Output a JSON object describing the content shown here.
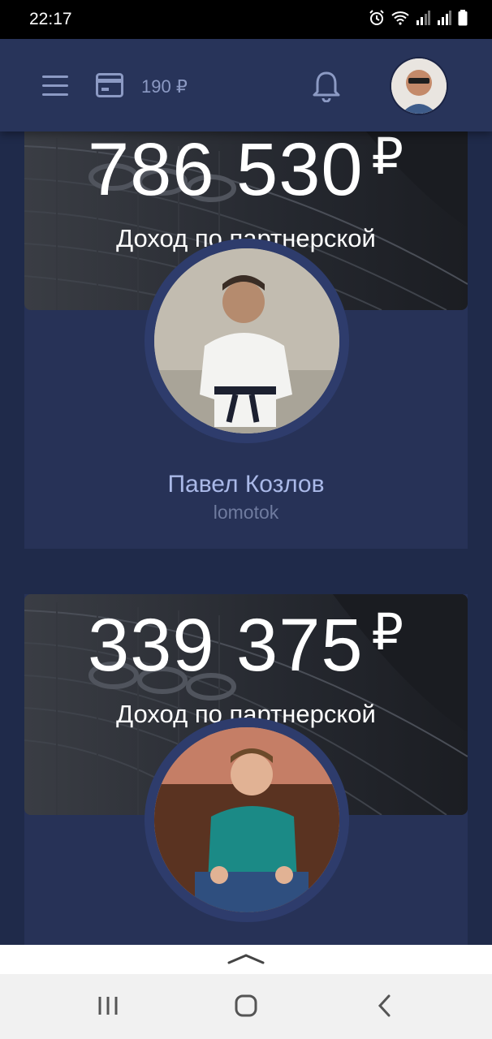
{
  "status_bar": {
    "time": "22:17",
    "icons": [
      "alarm-icon",
      "wifi-icon",
      "signal-icon",
      "signal-icon",
      "battery-icon"
    ]
  },
  "header": {
    "balance": "190 ₽",
    "icons": [
      "menu-icon",
      "wallet-icon",
      "bell-icon"
    ]
  },
  "cards": [
    {
      "amount": "786 530",
      "currency": "₽",
      "caption": "Доход по партнерской",
      "name": "Павел Козлов",
      "login": "lomotok"
    },
    {
      "amount": "339 375",
      "currency": "₽",
      "caption": "Доход по партнерской"
    }
  ],
  "colors": {
    "background": "#1f2a4a",
    "header": "#28345a",
    "card": "#273257",
    "name": "#aab9e8",
    "login": "#6f7b9f",
    "icon": "#8c9ac4"
  }
}
